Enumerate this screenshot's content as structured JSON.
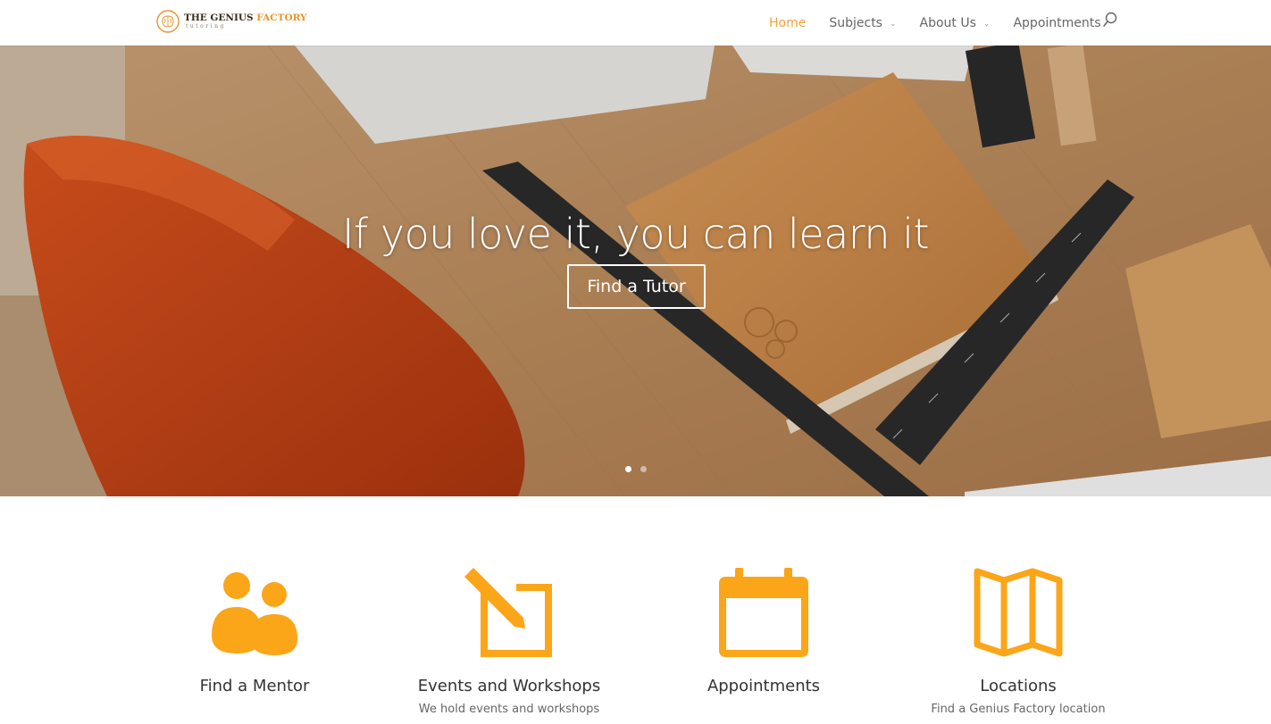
{
  "header": {
    "logo_title_prefix": "THE GENIUS ",
    "logo_title_accent": "FACTORY",
    "logo_subtitle": "tutoring",
    "nav": [
      {
        "label": "Home",
        "active": true,
        "dropdown": false
      },
      {
        "label": "Subjects",
        "active": false,
        "dropdown": true
      },
      {
        "label": "About Us",
        "active": false,
        "dropdown": true
      },
      {
        "label": "Appointments",
        "active": false,
        "dropdown": false
      }
    ],
    "search_icon": "search-icon"
  },
  "hero": {
    "title": "If you love it, you can learn it",
    "button_label": "Find a Tutor",
    "slides": 2,
    "active_slide": 1
  },
  "features": [
    {
      "icon": "people-icon",
      "title": "Find a Mentor",
      "subtitle": ""
    },
    {
      "icon": "edit-icon",
      "title": "Events and Workshops",
      "subtitle": "We hold events and workshops"
    },
    {
      "icon": "calendar-icon",
      "title": "Appointments",
      "subtitle": ""
    },
    {
      "icon": "map-icon",
      "title": "Locations",
      "subtitle": "Find a Genius Factory location"
    }
  ],
  "colors": {
    "accent": "#f0a23c",
    "icon_orange": "#fba519",
    "text_dark": "#333333",
    "text_mid": "#666666"
  }
}
